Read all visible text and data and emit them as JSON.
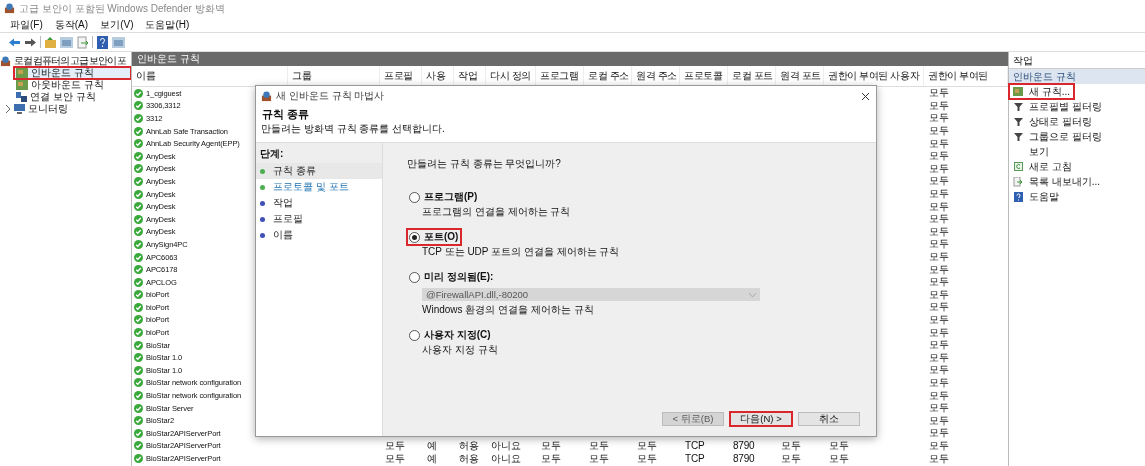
{
  "window": {
    "title": "고급 보안이 포함된 Windows Defender 방화벽"
  },
  "menu": [
    "파일(F)",
    "동작(A)",
    "보기(V)",
    "도움말(H)"
  ],
  "tree": {
    "root": "로컬 컴퓨터의 고급 보안이 포",
    "items": [
      {
        "label": "인바운드 규칙",
        "kind": "inbound",
        "selected": true,
        "highlighted": true,
        "has_children": false
      },
      {
        "label": "아웃바운드 규칙",
        "kind": "outbound",
        "selected": false,
        "highlighted": false,
        "has_children": false
      },
      {
        "label": "연결 보안 규칙",
        "kind": "connection",
        "selected": false,
        "highlighted": false,
        "has_children": false
      },
      {
        "label": "모니터링",
        "kind": "monitor",
        "selected": false,
        "highlighted": false,
        "has_children": true
      }
    ]
  },
  "rules": {
    "title": "인바운드 규칙",
    "columns": [
      "이름",
      "그룹",
      "프로필",
      "사용",
      "작업",
      "다시 정의",
      "프로그램",
      "로컬 주소",
      "원격 주소",
      "프로토콜",
      "로컬 포트",
      "원격 포트",
      "권한이 부여된 사용자",
      "권한이 부여된"
    ],
    "rows": [
      {
        "name": "1_cgiguest",
        "last_column": "모두"
      },
      {
        "name": "3306,3312",
        "last_column": "모두"
      },
      {
        "name": "3312",
        "last_column": "모두"
      },
      {
        "name": "AhnLab Safe Transaction",
        "last_column": "모두"
      },
      {
        "name": "AhnLab Security Agent(EPP)",
        "last_column": "모두"
      },
      {
        "name": "AnyDesk",
        "last_column": "모두"
      },
      {
        "name": "AnyDesk",
        "last_column": "모두"
      },
      {
        "name": "AnyDesk",
        "last_column": "모두"
      },
      {
        "name": "AnyDesk",
        "last_column": "모두"
      },
      {
        "name": "AnyDesk",
        "last_column": "모두"
      },
      {
        "name": "AnyDesk",
        "last_column": "모두"
      },
      {
        "name": "AnyDesk",
        "last_column": "모두"
      },
      {
        "name": "AnySign4PC",
        "last_column": "모두"
      },
      {
        "name": "APC6063",
        "last_column": "모두"
      },
      {
        "name": "APC6178",
        "last_column": "모두"
      },
      {
        "name": "APCLOG",
        "last_column": "모두"
      },
      {
        "name": "bioPort",
        "last_column": "모두"
      },
      {
        "name": "bioPort",
        "last_column": "모두"
      },
      {
        "name": "bioPort",
        "last_column": "모두"
      },
      {
        "name": "bioPort",
        "last_column": "모두"
      },
      {
        "name": "BioStar",
        "last_column": "모두"
      },
      {
        "name": "BioStar 1.0",
        "last_column": "모두"
      },
      {
        "name": "BioStar 1.0",
        "last_column": "모두"
      },
      {
        "name": "BioStar network configuration",
        "last_column": "모두"
      },
      {
        "name": "BioStar network configuration",
        "last_column": "모두"
      },
      {
        "name": "BioStar Server",
        "last_column": "모두"
      },
      {
        "name": "BioStar2",
        "last_column": "모두"
      },
      {
        "name": "BioStar2APIServerPort",
        "last_column": "모두"
      },
      {
        "name": "BioStar2APIServerPort",
        "cells": [
          "모두",
          "예",
          "허용",
          "아니요",
          "모두",
          "모두",
          "모두",
          "TCP",
          "8790",
          "모두",
          "모두"
        ],
        "last_column": "모두"
      },
      {
        "name": "BioStar2APIServerPort",
        "cells": [
          "모두",
          "예",
          "허용",
          "아니요",
          "모두",
          "모두",
          "모두",
          "TCP",
          "8790",
          "모두",
          "모두"
        ],
        "last_column": "모두"
      }
    ]
  },
  "actions": {
    "title": "작업",
    "section": "인바운드 규칙",
    "items": [
      {
        "label": "새 규칙...",
        "kind": "rule",
        "highlighted": true
      },
      {
        "label": "프로필별 필터링",
        "kind": "filter",
        "highlighted": false
      },
      {
        "label": "상태로 필터링",
        "kind": "filter",
        "highlighted": false
      },
      {
        "label": "그룹으로 필터링",
        "kind": "filter",
        "highlighted": false
      },
      {
        "label": "보기",
        "kind": "view",
        "highlighted": false
      },
      {
        "label": "새로 고침",
        "kind": "refresh",
        "highlighted": false
      },
      {
        "label": "목록 내보내기...",
        "kind": "export",
        "highlighted": false
      },
      {
        "label": "도움말",
        "kind": "help",
        "highlighted": false
      }
    ]
  },
  "wizard": {
    "title": "새 인바운드 규칙 마법사",
    "heading": "규칙 종류",
    "subtitle": "만들려는 방화벽 규칙 종류를 선택합니다.",
    "steps_label": "단계:",
    "steps": [
      {
        "label": "규칙 종류",
        "selected": true,
        "color": "#4caf50"
      },
      {
        "label": "프로토콜 및 포트",
        "selected": false,
        "color": "#4caf50"
      },
      {
        "label": "작업",
        "selected": false,
        "color": "#3f51b5"
      },
      {
        "label": "프로필",
        "selected": false,
        "color": "#3f51b5"
      },
      {
        "label": "이름",
        "selected": false,
        "color": "#3f51b5"
      }
    ],
    "question": "만들려는 규칙 종류는 무엇입니까?",
    "options": [
      {
        "label": "프로그램(P)",
        "description": "프로그램의 연결을 제어하는 규칙",
        "selected": false,
        "highlighted": false
      },
      {
        "label": "포트(O)",
        "description": "TCP 또는 UDP 포트의 연결을 제어하는 규칙",
        "selected": true,
        "highlighted": true
      },
      {
        "label": "미리 정의됨(E):",
        "select_value": "@FirewallAPI.dll,-80200",
        "description": "Windows 환경의 연결을 제어하는 규칙",
        "selected": false,
        "highlighted": false
      },
      {
        "label": "사용자 지정(C)",
        "description": "사용자 지정 규칙",
        "selected": false,
        "highlighted": false
      }
    ],
    "buttons": [
      {
        "label": "< 뒤로(B)",
        "disabled": true,
        "highlighted": false
      },
      {
        "label": "다음(N) >",
        "disabled": false,
        "highlighted": true
      },
      {
        "label": "취소",
        "disabled": false,
        "highlighted": false
      }
    ]
  }
}
